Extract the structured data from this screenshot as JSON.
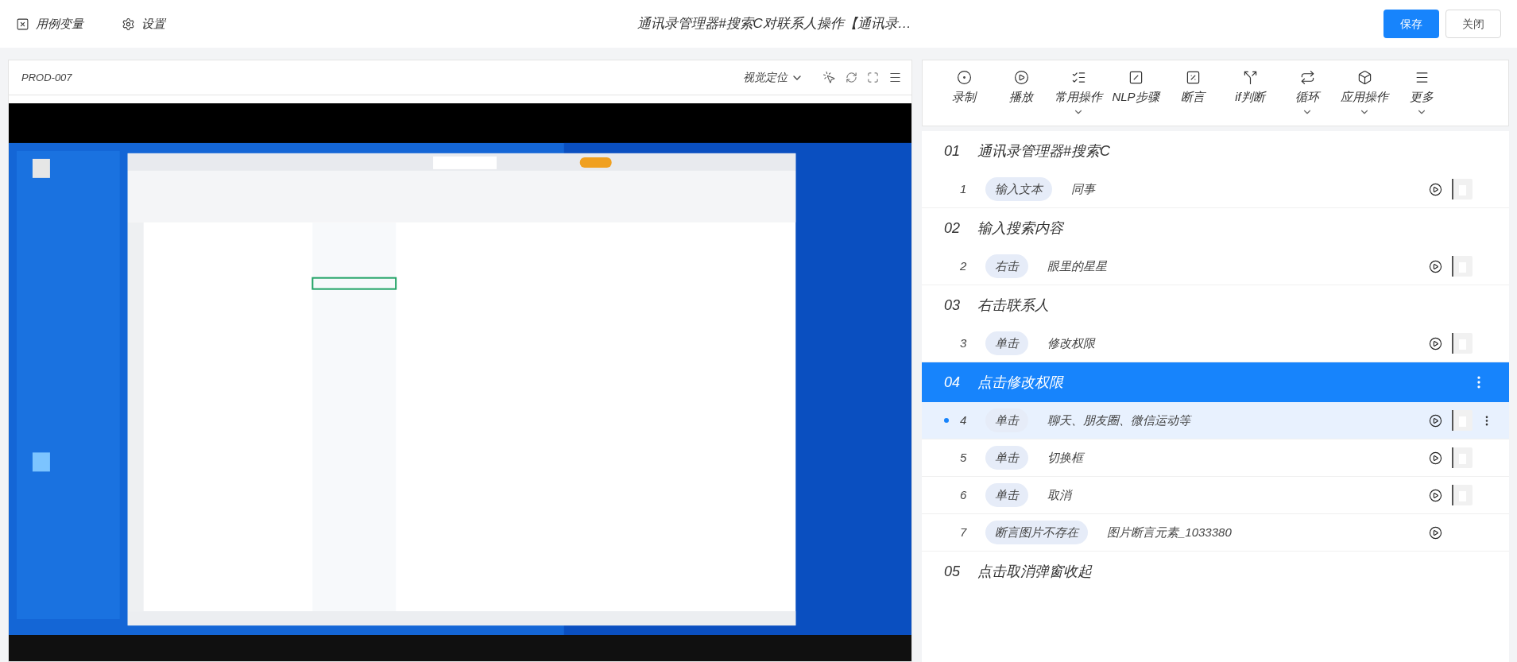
{
  "top_bar": {
    "variables_button": "用例变量",
    "settings_button": "设置",
    "title": "通讯录管理器#搜索C对联系人操作【通讯录…",
    "buttons": [
      {
        "label": "保存",
        "primary": true
      },
      {
        "label": "关闭",
        "primary": false
      }
    ]
  },
  "device_panel": {
    "device_id": "PROD-007",
    "mode_dropdown": "视觉定位"
  },
  "toolbar": [
    {
      "label": "录制",
      "kind": "record",
      "has_menu": false
    },
    {
      "label": "播放",
      "kind": "play",
      "has_menu": false
    },
    {
      "label": "常用操作",
      "kind": "list",
      "has_menu": true
    },
    {
      "label": "NLP步骤",
      "kind": "slash",
      "has_menu": false
    },
    {
      "label": "断言",
      "kind": "percent",
      "has_menu": false
    },
    {
      "label": "if判断",
      "kind": "branch",
      "has_menu": false
    },
    {
      "label": "循环",
      "kind": "loop",
      "has_menu": true
    },
    {
      "label": "应用操作",
      "kind": "cube",
      "has_menu": true
    },
    {
      "label": "更多",
      "kind": "menu",
      "has_menu": true
    }
  ],
  "groups": [
    {
      "number": "01",
      "title": "通讯录管理器#搜索C",
      "selected": false,
      "steps": [
        {
          "number": "1",
          "action": "输入文本",
          "target": "同事",
          "selected": false,
          "thumbnail": true
        }
      ]
    },
    {
      "number": "02",
      "title": "输入搜索内容",
      "selected": false,
      "steps": [
        {
          "number": "2",
          "action": "右击",
          "target": "眼里的星星",
          "selected": false,
          "thumbnail": true
        }
      ]
    },
    {
      "number": "03",
      "title": "右击联系人",
      "selected": false,
      "steps": [
        {
          "number": "3",
          "action": "单击",
          "target": "修改权限",
          "selected": false,
          "thumbnail": true
        }
      ]
    },
    {
      "number": "04",
      "title": "点击修改权限",
      "selected": true,
      "steps": [
        {
          "number": "4",
          "action": "单击",
          "target": "聊天、朋友圈、微信运动等",
          "selected": true,
          "thumbnail": true
        },
        {
          "number": "5",
          "action": "单击",
          "target": "切换框",
          "selected": false,
          "thumbnail": true
        },
        {
          "number": "6",
          "action": "单击",
          "target": "取消",
          "selected": false,
          "thumbnail": true
        },
        {
          "number": "7",
          "action": "断言图片不存在",
          "target": "图片断言元素_1033380",
          "selected": false,
          "thumbnail": false
        }
      ]
    },
    {
      "number": "05",
      "title": "点击取消弹窗收起",
      "selected": false
    }
  ]
}
